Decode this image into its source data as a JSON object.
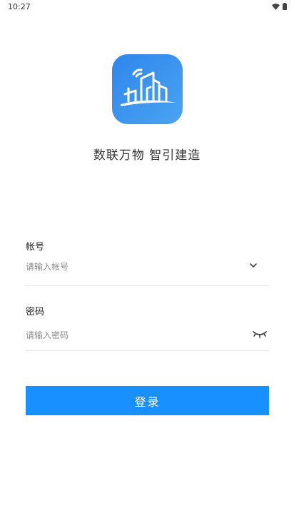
{
  "status_bar": {
    "time": "10:27"
  },
  "app": {
    "slogan": "数联万物 智引建造"
  },
  "form": {
    "account": {
      "label": "帐号",
      "placeholder": "请输入帐号"
    },
    "password": {
      "label": "密码",
      "placeholder": "请输入密码"
    },
    "submit_label": "登录"
  },
  "colors": {
    "primary": "#1890ff",
    "logo_background": "#3a93ee"
  }
}
